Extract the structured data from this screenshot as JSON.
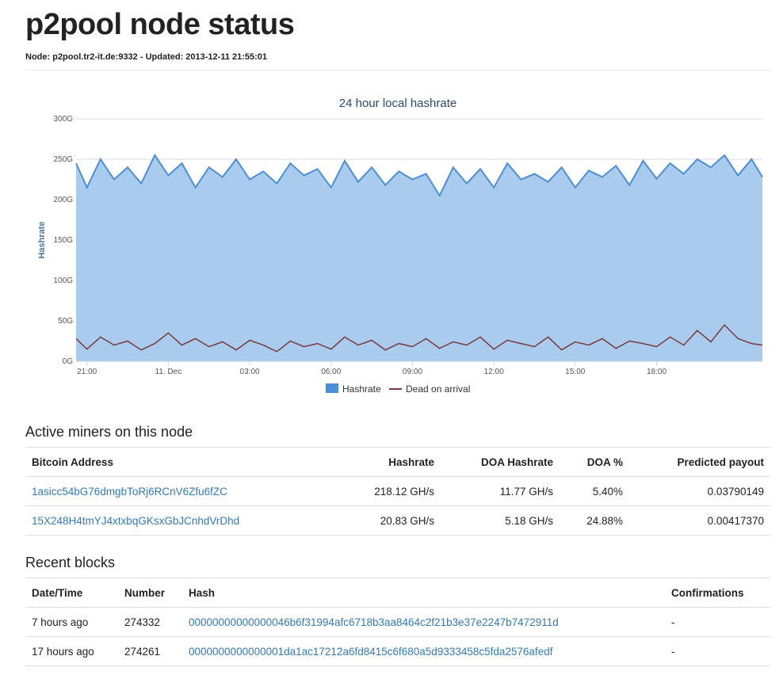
{
  "page": {
    "title": "p2pool node status",
    "subtitle": "Node: p2pool.tr2-it.de:9332 - Updated: 2013-12-11 21:55:01"
  },
  "chart_data": {
    "type": "area",
    "title": "24 hour local hashrate",
    "xlabel": "",
    "ylabel": "Hashrate",
    "y_ticks": [
      "0G",
      "50G",
      "100G",
      "150G",
      "200G",
      "250G",
      "300G"
    ],
    "ylim": [
      0,
      300
    ],
    "x_tick_labels": [
      "21:00",
      "11. Dec",
      "03:00",
      "06:00",
      "09:00",
      "12:00",
      "15:00",
      "18:00"
    ],
    "x_tick_hours": [
      21,
      24,
      27,
      30,
      33,
      36,
      39,
      42
    ],
    "xlim_hours": [
      20.6,
      45.9
    ],
    "grid": true,
    "legend_position": "bottom-center",
    "series": [
      {
        "name": "Hashrate",
        "color": "#4a8fd8",
        "fill": "#a9cbee",
        "x_hours": [
          20.6,
          21.0,
          21.5,
          22.0,
          22.5,
          23.0,
          23.5,
          24.0,
          24.5,
          25.0,
          25.5,
          26.0,
          26.5,
          27.0,
          27.5,
          28.0,
          28.5,
          29.0,
          29.5,
          30.0,
          30.5,
          31.0,
          31.5,
          32.0,
          32.5,
          33.0,
          33.5,
          34.0,
          34.5,
          35.0,
          35.5,
          36.0,
          36.5,
          37.0,
          37.5,
          38.0,
          38.5,
          39.0,
          39.5,
          40.0,
          40.5,
          41.0,
          41.5,
          42.0,
          42.5,
          43.0,
          43.5,
          44.0,
          44.5,
          45.0,
          45.5,
          45.9
        ],
        "values": [
          245,
          215,
          250,
          225,
          240,
          220,
          255,
          230,
          245,
          215,
          240,
          228,
          250,
          225,
          235,
          220,
          245,
          230,
          238,
          215,
          248,
          222,
          240,
          218,
          235,
          225,
          232,
          205,
          240,
          220,
          238,
          215,
          245,
          225,
          232,
          222,
          240,
          215,
          236,
          228,
          242,
          218,
          248,
          226,
          245,
          232,
          250,
          240,
          255,
          230,
          250,
          228
        ]
      },
      {
        "name": "Dead on arrival",
        "color": "#7a3b3b",
        "x_hours": [
          20.6,
          21.0,
          21.5,
          22.0,
          22.5,
          23.0,
          23.5,
          24.0,
          24.5,
          25.0,
          25.5,
          26.0,
          26.5,
          27.0,
          27.5,
          28.0,
          28.5,
          29.0,
          29.5,
          30.0,
          30.5,
          31.0,
          31.5,
          32.0,
          32.5,
          33.0,
          33.5,
          34.0,
          34.5,
          35.0,
          35.5,
          36.0,
          36.5,
          37.0,
          37.5,
          38.0,
          38.5,
          39.0,
          39.5,
          40.0,
          40.5,
          41.0,
          41.5,
          42.0,
          42.5,
          43.0,
          43.5,
          44.0,
          44.5,
          45.0,
          45.5,
          45.9
        ],
        "values": [
          28,
          15,
          30,
          20,
          25,
          14,
          22,
          35,
          20,
          28,
          18,
          24,
          14,
          26,
          20,
          12,
          25,
          18,
          22,
          15,
          30,
          20,
          26,
          14,
          22,
          18,
          28,
          16,
          24,
          20,
          30,
          15,
          26,
          22,
          18,
          30,
          14,
          24,
          20,
          28,
          16,
          25,
          22,
          18,
          30,
          20,
          38,
          24,
          45,
          28,
          22,
          20
        ]
      }
    ]
  },
  "miners": {
    "heading": "Active miners on this node",
    "columns": [
      "Bitcoin Address",
      "Hashrate",
      "DOA Hashrate",
      "DOA %",
      "Predicted payout"
    ],
    "rows": [
      {
        "address": "1asicc54bG76dmgbToRj6RCnV6Zfu6fZC",
        "hashrate": "218.12 GH/s",
        "doa_hashrate": "11.77 GH/s",
        "doa_pct": "5.40%",
        "payout": "0.03790149"
      },
      {
        "address": "15X248H4tmYJ4xtxbqGKsxGbJCnhdVrDhd",
        "hashrate": "20.83 GH/s",
        "doa_hashrate": "5.18 GH/s",
        "doa_pct": "24.88%",
        "payout": "0.00417370"
      }
    ]
  },
  "blocks": {
    "heading": "Recent blocks",
    "columns": [
      "Date/Time",
      "Number",
      "Hash",
      "Confirmations"
    ],
    "rows": [
      {
        "time": "7 hours ago",
        "number": "274332",
        "hash": "00000000000000046b6f31994afc6718b3aa8464c2f21b3e37e2247b7472911d",
        "confirmations": "-"
      },
      {
        "time": "17 hours ago",
        "number": "274261",
        "hash": "0000000000000001da1ac17212a6fd8415c6f680a5d9333458c5fda2576afedf",
        "confirmations": "-"
      }
    ]
  }
}
